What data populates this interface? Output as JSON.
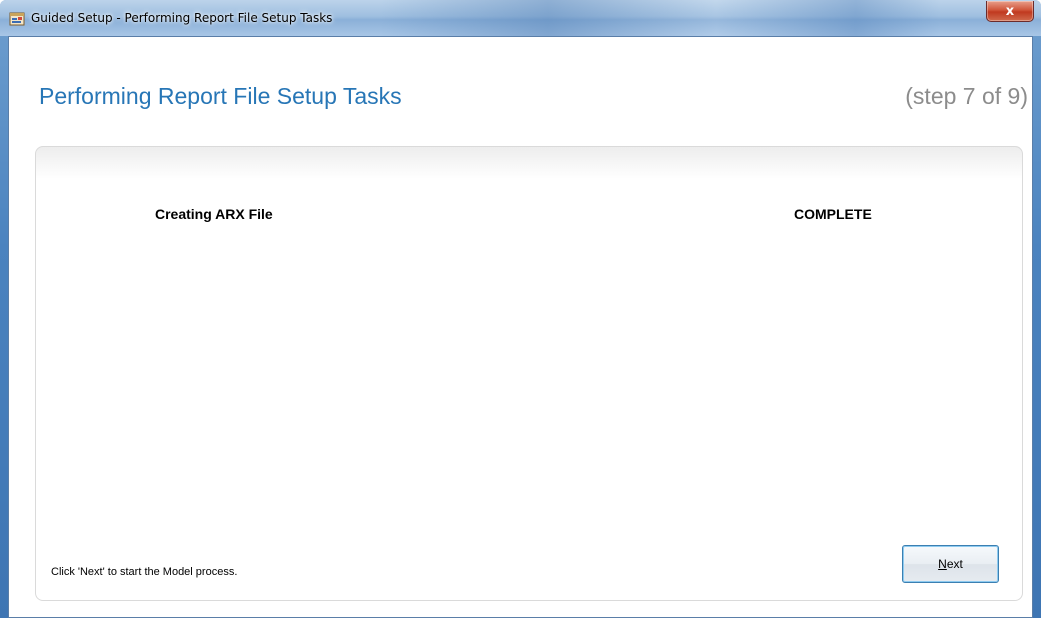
{
  "window": {
    "title": "Guided Setup - Performing Report File Setup Tasks",
    "close_glyph": "x"
  },
  "header": {
    "title": "Performing Report File Setup Tasks",
    "step": "(step 7 of 9)"
  },
  "task": {
    "label": "Creating ARX File",
    "status": "COMPLETE"
  },
  "footer": {
    "hint": "Click 'Next' to start the Model process.",
    "next_label_mnemonic": "N",
    "next_label_rest": "ext"
  },
  "colors": {
    "title_accent": "#2776b6",
    "step_gray": "#8c8c8c"
  },
  "icons": {
    "app": "app-icon",
    "close": "close-icon"
  }
}
